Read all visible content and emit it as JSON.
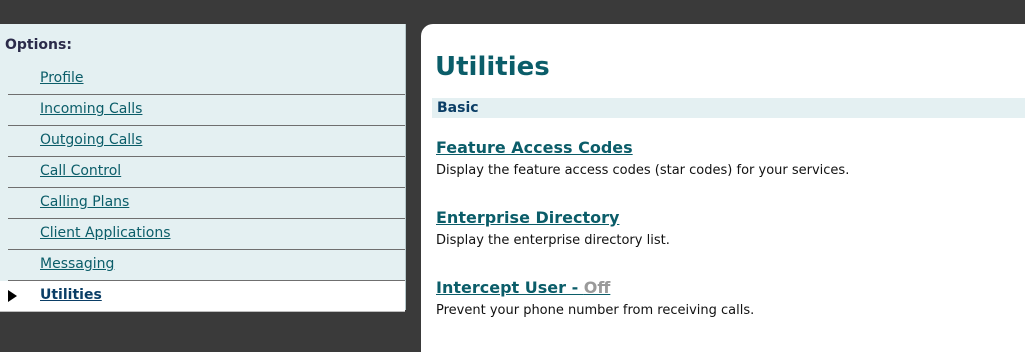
{
  "sidebar": {
    "title": "Options:",
    "items": [
      {
        "label": "Profile"
      },
      {
        "label": "Incoming Calls"
      },
      {
        "label": "Outgoing Calls"
      },
      {
        "label": "Call Control"
      },
      {
        "label": "Calling Plans"
      },
      {
        "label": "Client Applications"
      },
      {
        "label": "Messaging"
      },
      {
        "label": "Utilities"
      }
    ]
  },
  "main": {
    "title": "Utilities",
    "section": "Basic",
    "utilities": [
      {
        "label": "Feature Access Codes",
        "description": "Display the feature access codes (star codes) for your services."
      },
      {
        "label": "Enterprise Directory",
        "description": "Display the enterprise directory list."
      },
      {
        "label": "Intercept User - ",
        "status": "Off",
        "description": "Prevent your phone number from receiving calls."
      }
    ]
  }
}
